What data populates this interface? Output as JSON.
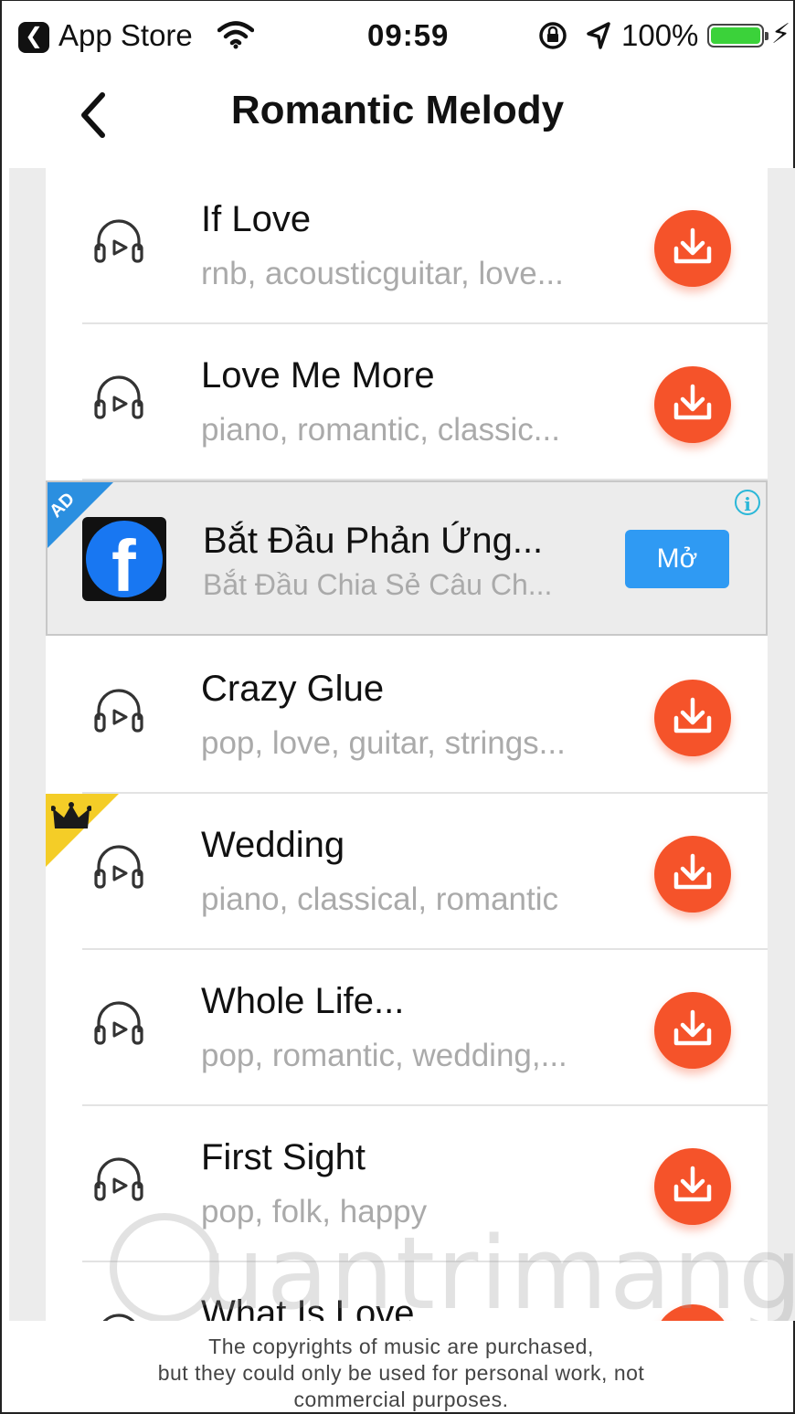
{
  "status_bar": {
    "back_app_label": "App Store",
    "time": "09:59",
    "battery_percent": "100%",
    "battery_level": 1.0,
    "battery_color": "#3bd23a"
  },
  "header": {
    "title": "Romantic Melody",
    "back_icon": "chevron-left-icon"
  },
  "songs": [
    {
      "title": "If Love",
      "tags": "rnb, acousticguitar, love...",
      "premium": false
    },
    {
      "title": "Love Me More",
      "tags": "piano, romantic, classic...",
      "premium": false
    },
    {
      "title": "Crazy Glue",
      "tags": "pop, love, guitar, strings...",
      "premium": false
    },
    {
      "title": "Wedding",
      "tags": "piano, classical, romantic",
      "premium": true
    },
    {
      "title": "Whole Life...",
      "tags": "pop, romantic, wedding,...",
      "premium": false
    },
    {
      "title": "First Sight",
      "tags": "pop, folk, happy",
      "premium": false
    },
    {
      "title": "What Is Love",
      "tags": "",
      "premium": false
    }
  ],
  "ad": {
    "badge": "AD",
    "title": "Bắt Đầu Phản Ứng...",
    "subtitle": "Bắt Đầu Chia Sẻ Câu Ch...",
    "button_label": "Mở",
    "logo_letter": "f",
    "info_glyph": "i"
  },
  "watermark": {
    "text": "uantrimang"
  },
  "footer": {
    "line1": "The copyrights of music are purchased,",
    "line2": "but they could only be used for personal work, not",
    "line3": "commercial purposes."
  },
  "colors": {
    "download_button": "#f5532a",
    "ad_button": "#2f9af3",
    "ad_corner": "#2b8fe0",
    "premium_corner": "#f4cd27"
  }
}
